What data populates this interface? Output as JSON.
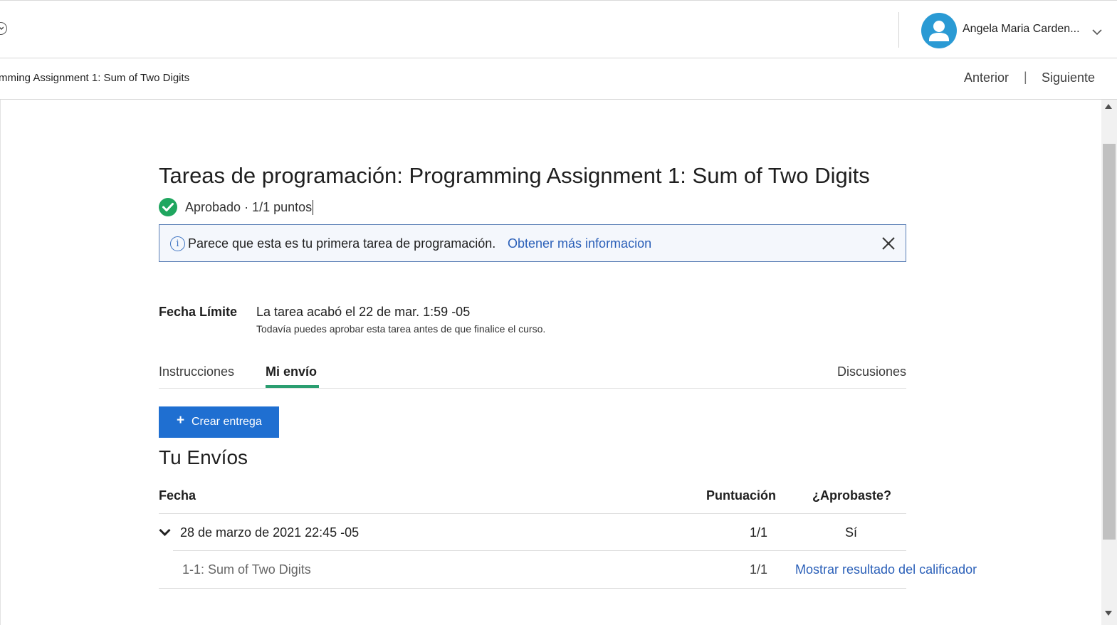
{
  "header": {
    "user_name": "Angela Maria Carden...",
    "avatar_icon": "user-avatar-icon",
    "menu_icon": "chevron-down-icon"
  },
  "breadcrumb": {
    "text": "mming Assignment 1: Sum of Two Digits",
    "prev_label": "Anterior",
    "separator": "|",
    "next_label": "Siguiente"
  },
  "assignment": {
    "title": "Tareas de programación: Programming Assignment 1: Sum of Two Digits",
    "status_text": "Aprobado · 1/1 puntos",
    "status_icon": "check-circle-icon"
  },
  "info_banner": {
    "icon": "info-icon",
    "text": "Parece que esta es tu primera tarea de programación.",
    "link": "Obtener más informacion",
    "close_icon": "close-icon"
  },
  "deadline": {
    "label": "Fecha Límite",
    "value": "La tarea acabó el 22 de mar. 1:59 -05",
    "note": "Todavía puedes aprobar esta tarea antes de que finalice el curso."
  },
  "tabs": [
    {
      "label": "Instrucciones",
      "active": false
    },
    {
      "label": "Mi envío",
      "active": true
    },
    {
      "label": "Discusiones",
      "active": false
    }
  ],
  "create_button": {
    "icon": "plus-icon",
    "label": "Crear entrega"
  },
  "submissions": {
    "title": "Tu Envíos",
    "columns": [
      "Fecha",
      "Puntuación",
      "¿Aprobaste?"
    ],
    "rows": [
      {
        "date": "28 de marzo de 2021 22:45 -05",
        "score": "1/1",
        "passed": "Sí",
        "parts": [
          {
            "name": "1-1: Sum of Two Digits",
            "score": "1/1",
            "action": "Mostrar resultado del calificador"
          }
        ]
      }
    ]
  },
  "colors": {
    "accent_blue": "#1f6fd1",
    "link_blue": "#2a5fb8",
    "success_green": "#1fa65f",
    "tab_underline": "#2a9e70",
    "avatar_blue": "#2a9ad4"
  }
}
